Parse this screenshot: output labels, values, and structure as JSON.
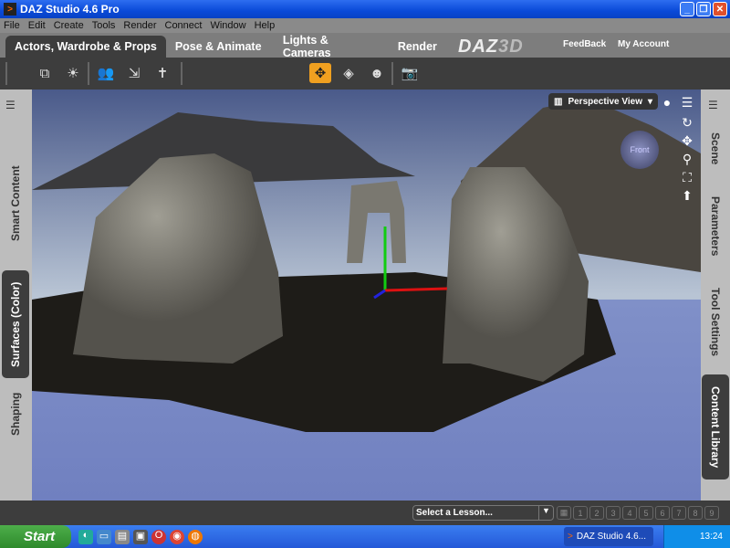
{
  "window": {
    "title": "DAZ Studio 4.6 Pro",
    "minimize": "_",
    "restore": "❐",
    "close": "✕"
  },
  "menu": [
    "File",
    "Edit",
    "Create",
    "Tools",
    "Render",
    "Connect",
    "Window",
    "Help"
  ],
  "tabs": [
    "Actors, Wardrobe & Props",
    "Pose & Animate",
    "Lights & Cameras",
    "Render"
  ],
  "brand": {
    "logo": "DAZ3D",
    "feedback": "FeedBack",
    "account": "My Account"
  },
  "viewport": {
    "view_label": "Perspective View",
    "cube_face": "Front"
  },
  "left_panels": [
    "Smart Content",
    "Surfaces (Color)",
    "Shaping"
  ],
  "right_panels": [
    "Scene",
    "Parameters",
    "Tool Settings",
    "Content Library"
  ],
  "lessons": {
    "placeholder": "Select a Lesson...",
    "steps": [
      "1",
      "2",
      "3",
      "4",
      "5",
      "6",
      "7",
      "8",
      "9"
    ]
  },
  "taskbar": {
    "start": "Start",
    "task": "DAZ Studio 4.6...",
    "clock": "13:24"
  },
  "colors": {
    "accent": "#f0a020",
    "panel": "#3d3d3d"
  }
}
